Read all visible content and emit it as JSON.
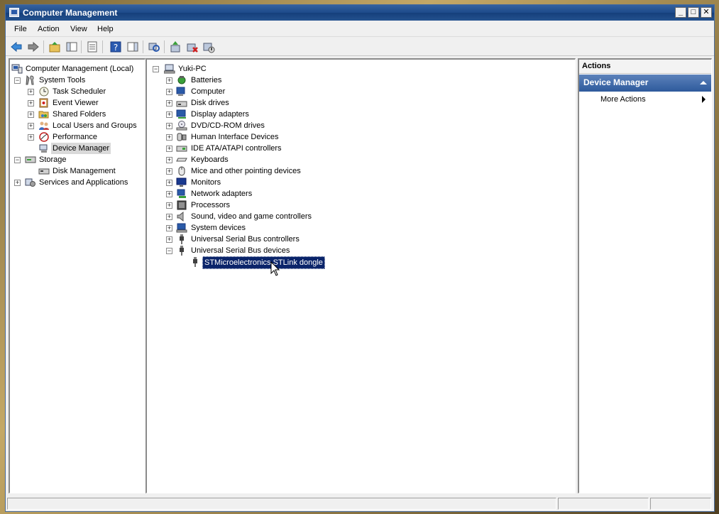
{
  "window": {
    "title": "Computer Management"
  },
  "window_buttons": {
    "minimize": "_",
    "maximize": "□",
    "close": "✕"
  },
  "menu": [
    "File",
    "Action",
    "View",
    "Help"
  ],
  "toolbar_icons": [
    "back-arrow-icon",
    "forward-arrow-icon",
    "up-folder-icon",
    "show-hide-tree-icon",
    "properties-icon",
    "help-icon",
    "show-hide-action-pane-icon",
    "scan-hardware-icon",
    "update-driver-icon",
    "uninstall-icon",
    "disable-device-icon"
  ],
  "left_tree": {
    "root": "Computer Management (Local)",
    "items": [
      {
        "label": "System Tools",
        "level": 1,
        "expander": "−",
        "icon": "tools-icon"
      },
      {
        "label": "Task Scheduler",
        "level": 2,
        "expander": "+",
        "icon": "clock-icon"
      },
      {
        "label": "Event Viewer",
        "level": 2,
        "expander": "+",
        "icon": "event-viewer-icon"
      },
      {
        "label": "Shared Folders",
        "level": 2,
        "expander": "+",
        "icon": "shared-folder-icon"
      },
      {
        "label": "Local Users and Groups",
        "level": 2,
        "expander": "+",
        "icon": "users-icon"
      },
      {
        "label": "Performance",
        "level": 2,
        "expander": "+",
        "icon": "performance-icon"
      },
      {
        "label": "Device Manager",
        "level": 2,
        "expander": "",
        "icon": "device-manager-icon",
        "selected": true
      },
      {
        "label": "Storage",
        "level": 1,
        "expander": "−",
        "icon": "storage-icon"
      },
      {
        "label": "Disk Management",
        "level": 2,
        "expander": "",
        "icon": "disk-management-icon"
      },
      {
        "label": "Services and Applications",
        "level": 1,
        "expander": "+",
        "icon": "services-icon"
      }
    ]
  },
  "device_tree": {
    "root": "Yuki-PC",
    "items": [
      {
        "label": "Batteries",
        "icon": "battery-icon",
        "expander": "+"
      },
      {
        "label": "Computer",
        "icon": "computer-icon",
        "expander": "+"
      },
      {
        "label": "Disk drives",
        "icon": "disk-drive-icon",
        "expander": "+"
      },
      {
        "label": "Display adapters",
        "icon": "display-adapter-icon",
        "expander": "+"
      },
      {
        "label": "DVD/CD-ROM drives",
        "icon": "dvd-drive-icon",
        "expander": "+"
      },
      {
        "label": "Human Interface Devices",
        "icon": "hid-icon",
        "expander": "+"
      },
      {
        "label": "IDE ATA/ATAPI controllers",
        "icon": "ide-controller-icon",
        "expander": "+"
      },
      {
        "label": "Keyboards",
        "icon": "keyboard-icon",
        "expander": "+"
      },
      {
        "label": "Mice and other pointing devices",
        "icon": "mouse-icon",
        "expander": "+"
      },
      {
        "label": "Monitors",
        "icon": "monitor-icon",
        "expander": "+"
      },
      {
        "label": "Network adapters",
        "icon": "network-adapter-icon",
        "expander": "+"
      },
      {
        "label": "Processors",
        "icon": "processor-icon",
        "expander": "+"
      },
      {
        "label": "Sound, video and game controllers",
        "icon": "sound-icon",
        "expander": "+"
      },
      {
        "label": "System devices",
        "icon": "system-devices-icon",
        "expander": "+"
      },
      {
        "label": "Universal Serial Bus controllers",
        "icon": "usb-icon",
        "expander": "+"
      },
      {
        "label": "Universal Serial Bus devices",
        "icon": "usb-icon",
        "expander": "−"
      }
    ],
    "child": {
      "label": "STMicroelectronics STLink dongle",
      "icon": "usb-device-icon"
    }
  },
  "actions": {
    "header": "Actions",
    "section": "Device Manager",
    "items": [
      "More Actions"
    ]
  }
}
